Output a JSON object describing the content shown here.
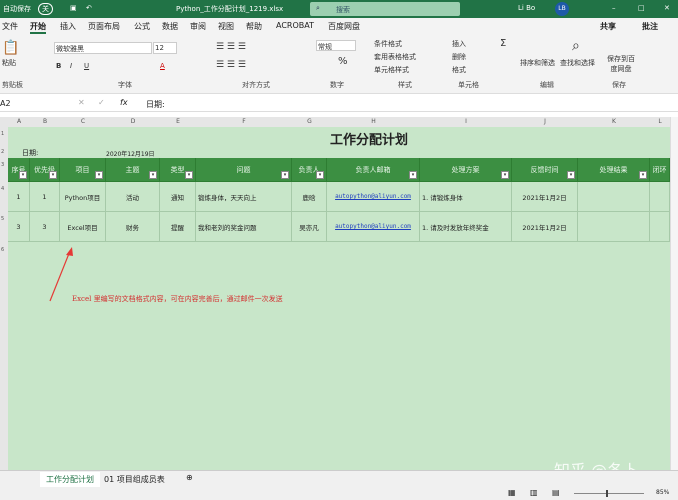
{
  "titlebar": {
    "autosave": "自动保存",
    "autosave_state": "关",
    "filename": "Python_工作分配计划_1219.xlsx",
    "search_placeholder": "搜索",
    "user": "Li Bo",
    "initials": "LB"
  },
  "tabs": [
    "文件",
    "开始",
    "插入",
    "页面布局",
    "公式",
    "数据",
    "审阅",
    "视图",
    "帮助",
    "ACROBAT",
    "百度网盘"
  ],
  "share": "共享",
  "comment": "批注",
  "ribbon": {
    "paste": "粘贴",
    "font_name": "微软雅黑",
    "font_size": "12",
    "number_format": "常规",
    "cond_format": "条件格式",
    "table_format": "套用表格格式",
    "cell_style": "单元格样式",
    "insert": "插入",
    "delete": "删除",
    "format": "格式",
    "sort_filter": "排序和筛选",
    "find_select": "查找和选择",
    "save_to": "保存到百度网盘",
    "groups": [
      "剪贴板",
      "字体",
      "对齐方式",
      "数字",
      "样式",
      "单元格",
      "编辑",
      "保存"
    ]
  },
  "formula": {
    "namebox": "A2",
    "content": "日期:"
  },
  "columns": [
    "A",
    "B",
    "C",
    "D",
    "E",
    "F",
    "G",
    "H",
    "I",
    "J",
    "K",
    "L"
  ],
  "sheet": {
    "title": "工作分配计划",
    "date_label": "日期:",
    "date_value": "2020年12月19日",
    "headers": [
      "序号",
      "优先级",
      "项目",
      "主题",
      "类型",
      "问题",
      "负责人",
      "负责人邮箱",
      "处理方案",
      "反馈时间",
      "处理结果",
      "闭环"
    ],
    "rows": [
      [
        "1",
        "1",
        "Python项目",
        "活动",
        "通知",
        "锻炼身体，天天向上",
        "鹿晗",
        "autopython@aliyun.com",
        "1. 请锻炼身体",
        "2021年1月2日",
        "",
        ""
      ],
      [
        "3",
        "3",
        "Excel项目",
        "财务",
        "提醒",
        "我和老刘的奖金问题",
        "吴亦凡",
        "autopython@aliyun.com",
        "1. 请及时发放年终奖金",
        "2021年1月2日",
        "",
        ""
      ]
    ],
    "annotation": "Excel 里编写的文档格式内容，可在内容完善后，通过邮件一次发送"
  },
  "sheet_tabs": [
    "工作分配计划",
    "01 项目组成员表"
  ],
  "zoom": "85%",
  "watermark": "知乎 @冬卜",
  "colors": {
    "accent": "#217346",
    "sheet_bg": "#c8e6c9",
    "header_bg": "#3c8f42",
    "arrow": "#e53935"
  }
}
